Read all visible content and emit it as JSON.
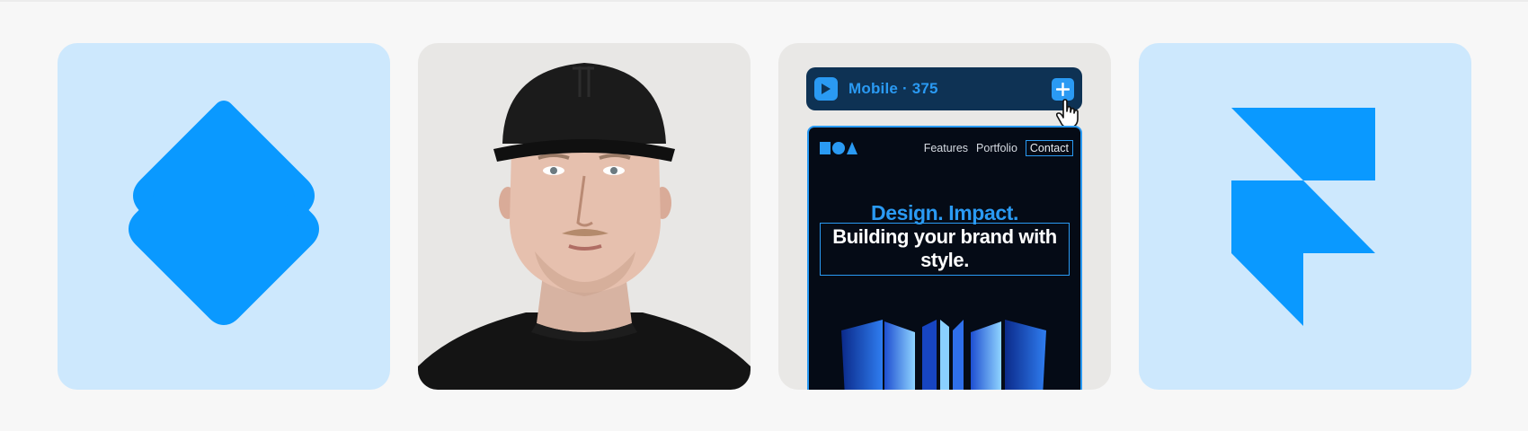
{
  "cards": [
    {
      "id": "brand-mark",
      "icon": "stacked-diamond-logo-icon",
      "background": "#cde8fd",
      "accent": "#0a99ff"
    },
    {
      "id": "portrait",
      "icon": "person-portrait-photo",
      "background": "#e8e7e5"
    },
    {
      "id": "builder-preview",
      "background": "#e9e8e6"
    },
    {
      "id": "framer-mark",
      "icon": "framer-logo-icon",
      "background": "#cde8fd",
      "accent": "#0a99ff"
    }
  ],
  "builder": {
    "breakpoint_label": "Mobile · 375",
    "play_icon": "play-icon",
    "add_icon": "plus-icon",
    "cursor_icon": "hand-pointer-icon",
    "bar_color": "#0e3254",
    "accent": "#2a9af3"
  },
  "site": {
    "nav": {
      "features": "Features",
      "portfolio": "Portfolio",
      "contact": "Contact"
    },
    "tagline": "Design. Impact.",
    "headline": "Building your brand with style.",
    "background": "#050b16"
  }
}
